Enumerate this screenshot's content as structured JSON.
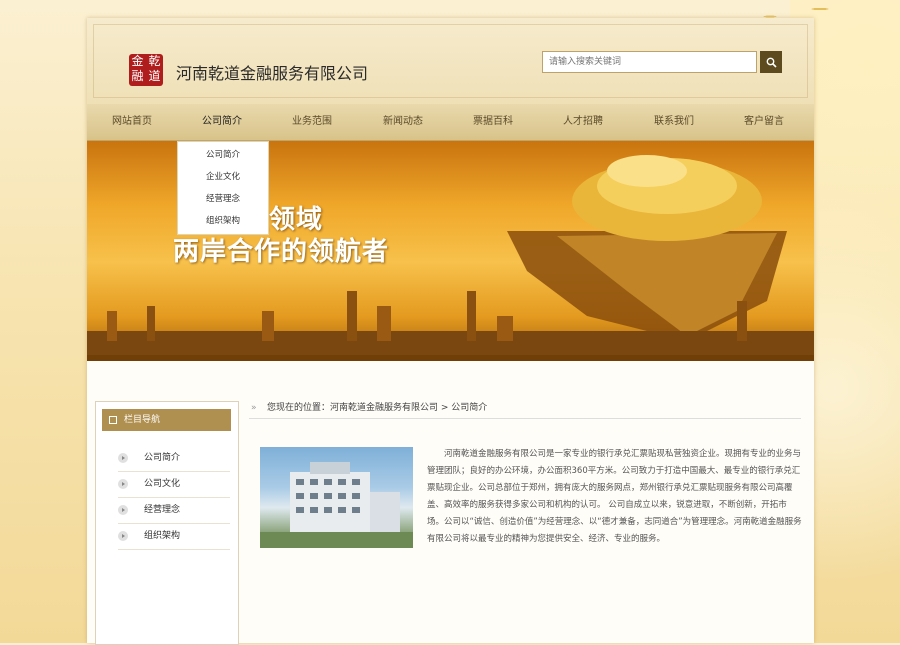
{
  "header": {
    "logo_chars": [
      "金",
      "乾",
      "融",
      "道"
    ],
    "company_name": "河南乾道金融服务有限公司",
    "search_placeholder": "请输入搜索关键词"
  },
  "nav": {
    "items": [
      "网站首页",
      "公司简介",
      "业务范围",
      "新闻动态",
      "票据百科",
      "人才招聘",
      "联系我们",
      "客户留言"
    ],
    "active": "公司简介"
  },
  "dropdown": {
    "items": [
      "公司简介",
      "企业文化",
      "经营理念",
      "组织架构"
    ]
  },
  "banner": {
    "line1": "融领域",
    "line2": "两岸合作的领航者"
  },
  "sidebar": {
    "title": "栏目导航",
    "items": [
      "公司简介",
      "公司文化",
      "经营理念",
      "组织架构"
    ]
  },
  "breadcrumb": {
    "arrow": "»",
    "text": "您现在的位置：河南乾道金融服务有限公司 > 公司简介"
  },
  "content": {
    "paragraph": "河南乾道金融服务有限公司是一家专业的银行承兑汇票贴现私营独资企业。现拥有专业的业务与管理团队；良好的办公环境，办公面积360平方米。公司致力于打造中国最大、最专业的银行承兑汇票贴现企业。公司总部位于郑州，拥有庞大的服务网点，郑州银行承兑汇票贴现服务有限公司高覆盖、高效率的服务获得多家公司和机构的认可。 公司自成立以来，锐意进取，不断创新，开拓市场。公司以“诚信、创造价值”为经营理念、以“德才兼备，志同道合”为管理理念。河南乾道金融服务有限公司将以最专业的精神为您提供安全、经济、专业的服务。"
  },
  "colors": {
    "nav_bg": "#dcc890",
    "sidebar_title_bg": "#b09050",
    "search_btn": "#5d4a1f",
    "seal": "#b01d1d"
  }
}
